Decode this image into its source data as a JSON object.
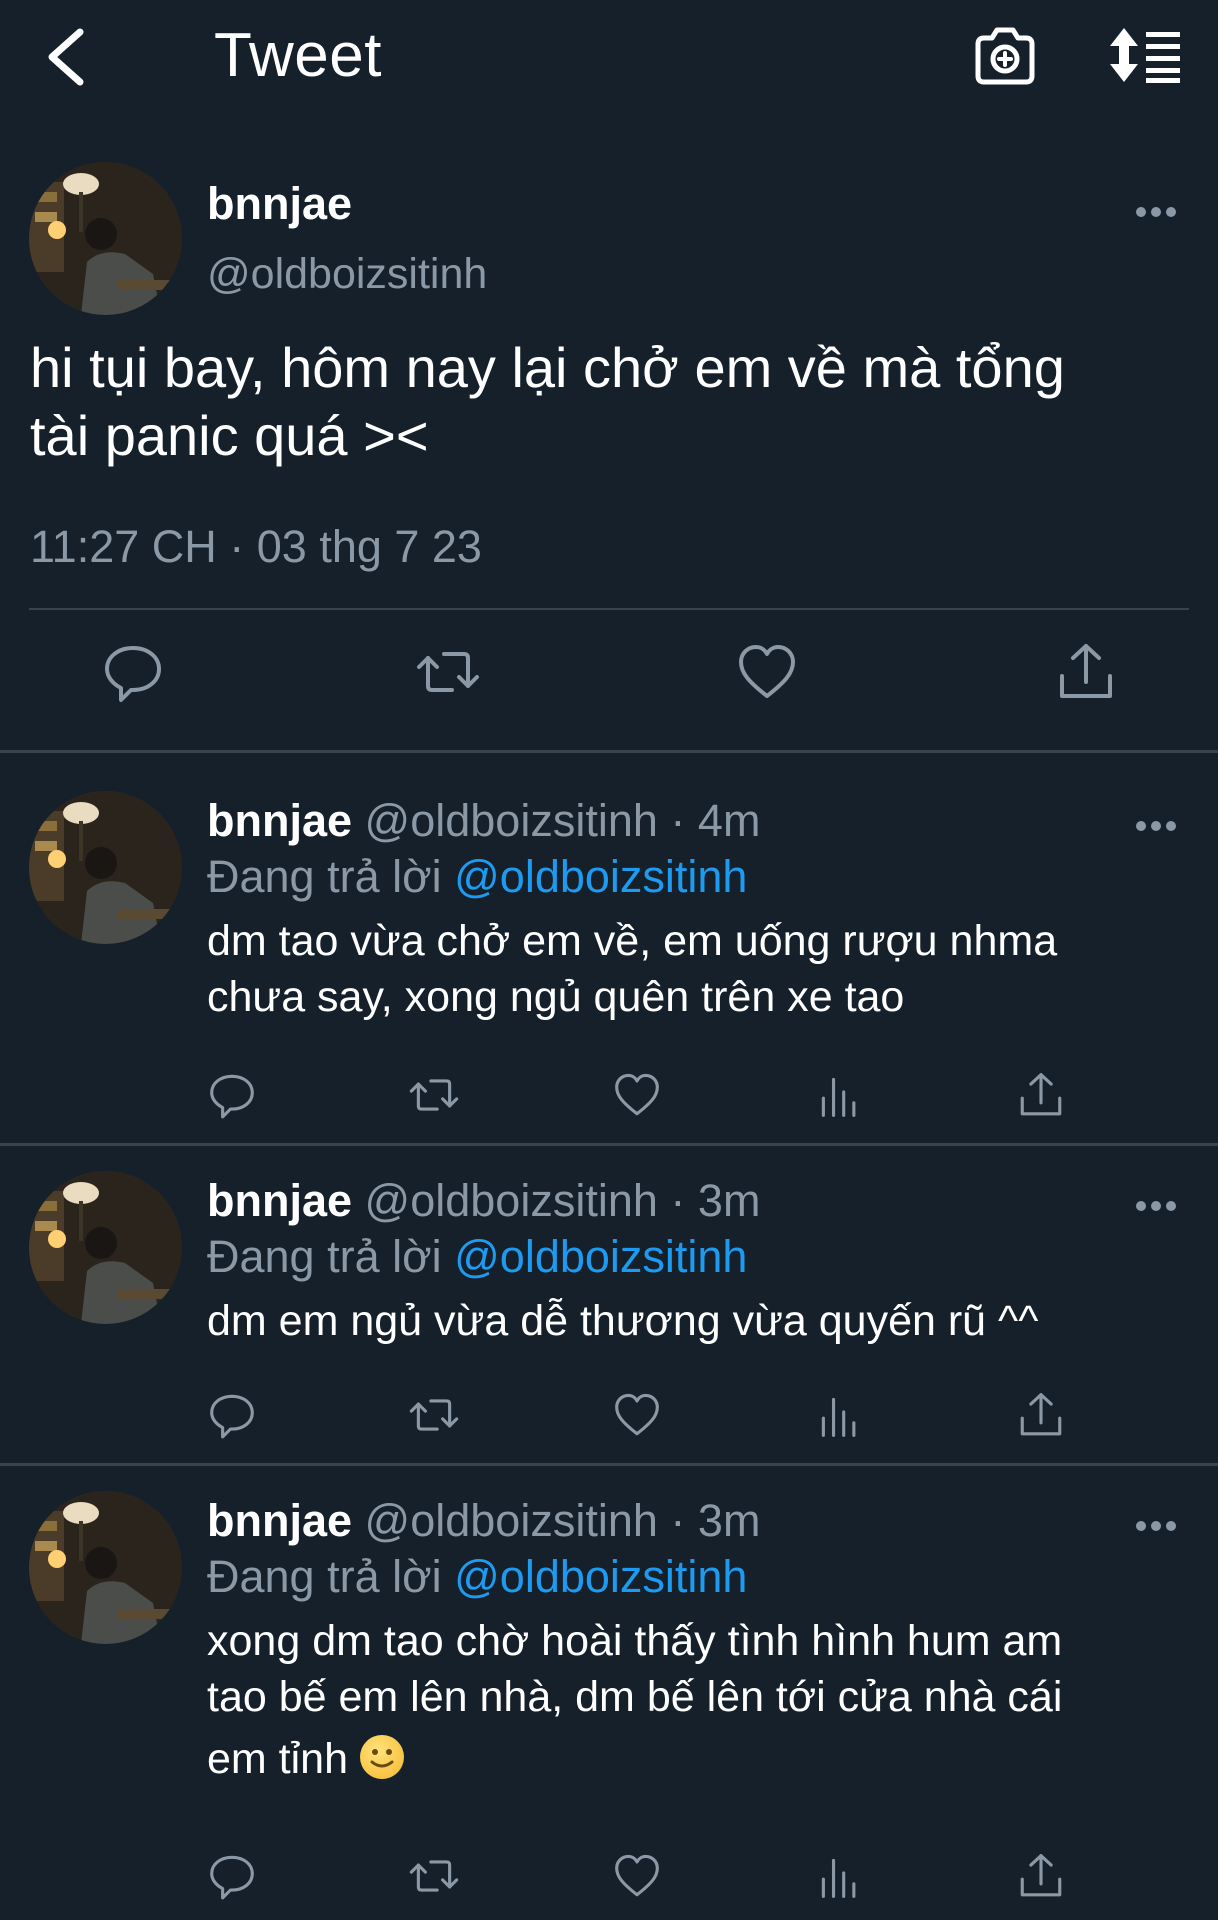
{
  "navbar": {
    "title": "Tweet",
    "back_icon": "chevron-left-icon",
    "camera_icon": "camera-plus-icon",
    "sort_icon": "sort-list-icon"
  },
  "main_tweet": {
    "name": "bnnjae",
    "handle": "@oldboizsitinh",
    "text_line1": "hi tụi bay, hôm nay lại chở em về mà tổng",
    "text_line2": "tài panic quá ><",
    "timestamp": "11:27 CH · 03 thg 7 23",
    "actions": [
      "reply-icon",
      "retweet-icon",
      "like-icon",
      "share-icon"
    ]
  },
  "replies": [
    {
      "name": "bnnjae",
      "handle": "@oldboizsitinh",
      "dot": "·",
      "time": "4m",
      "replying_prefix": "Đang trả lời",
      "replying_to": "@oldboizsitinh",
      "line1": "dm tao vừa chở em về, em uống rượu nhma",
      "line2": "chưa say, xong ngủ quên trên xe tao",
      "line3": ""
    },
    {
      "name": "bnnjae",
      "handle": "@oldboizsitinh",
      "dot": "·",
      "time": "3m",
      "replying_prefix": "Đang trả lời",
      "replying_to": "@oldboizsitinh",
      "line1": "dm em ngủ vừa dễ thương vừa quyến rũ ^^",
      "line2": "",
      "line3": ""
    },
    {
      "name": "bnnjae",
      "handle": "@oldboizsitinh",
      "dot": "·",
      "time": "3m",
      "replying_prefix": "Đang trả lời",
      "replying_to": "@oldboizsitinh",
      "line1": "xong dm tao chờ hoài thấy tình hình hum am",
      "line2": "tao bế em lên nhà, dm bế lên tới cửa nhà cái",
      "line3": "em tỉnh",
      "emoji": "slightly-smiling-face-emoji"
    }
  ],
  "colors": {
    "background": "#15202b",
    "divider": "#38444d",
    "secondary_text": "#8b98a5",
    "link": "#1d9bf0"
  }
}
